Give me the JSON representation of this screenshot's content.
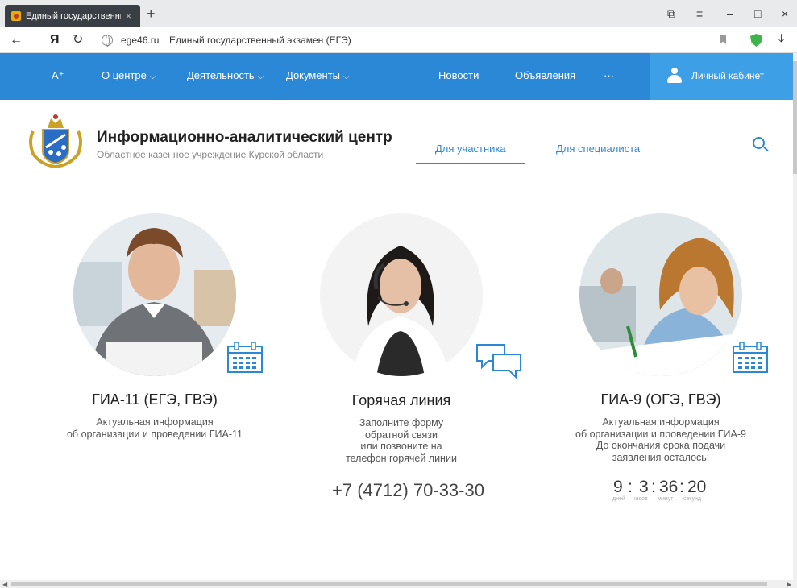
{
  "browser": {
    "tab_title": "Единый государственны",
    "tab_close": "×",
    "new_tab": "+",
    "back": "←",
    "yandex": "Я",
    "reload": "↻",
    "url_domain": "ege46.ru",
    "url_title": "Единый государственный экзамен (ЕГЭ)",
    "win_restore": "⧉",
    "win_menu": "≡",
    "win_min": "–",
    "win_max": "□",
    "win_close": "×",
    "download": "⤓"
  },
  "nav": {
    "font_size": "A⁺",
    "items": [
      {
        "label": "О центре",
        "chev": "⌵"
      },
      {
        "label": "Деятельность",
        "chev": "⌵"
      },
      {
        "label": "Документы",
        "chev": "⌵"
      },
      {
        "label": "Новости"
      },
      {
        "label": "Объявления"
      },
      {
        "label": "···"
      }
    ],
    "cabinet": "Личный кабинет"
  },
  "header": {
    "title": "Информационно-аналитический центр",
    "subtitle": "Областное казенное учреждение Курской области",
    "tabs": [
      {
        "label": "Для участника",
        "active": true
      },
      {
        "label": "Для специалиста",
        "active": false
      }
    ]
  },
  "cards": [
    {
      "title": "ГИА-11 (ЕГЭ, ГВЭ)",
      "lines": [
        "Актуальная информация",
        "об организации и проведении ГИА-11"
      ]
    },
    {
      "title": "Горячая линия",
      "lines": [
        "Заполните форму",
        "обратной связи",
        "или позвоните на",
        "телефон горячей линии"
      ],
      "phone": "+7 (4712) 70-33-30"
    },
    {
      "title": "ГИА-9 (ОГЭ, ГВЭ)",
      "lines": [
        "Актуальная информация",
        "об организации и проведении ГИА-9",
        "До окончания срока подачи",
        "заявления осталось:"
      ],
      "counter": {
        "days": "9",
        "hours": "3",
        "minutes": "36",
        "seconds": "20",
        "sep": ":",
        "labels": [
          "дней",
          "часов",
          "минут",
          "секунд"
        ]
      }
    }
  ],
  "colors": {
    "accent": "#2b88d6",
    "cabinet": "#3d9fe6"
  }
}
